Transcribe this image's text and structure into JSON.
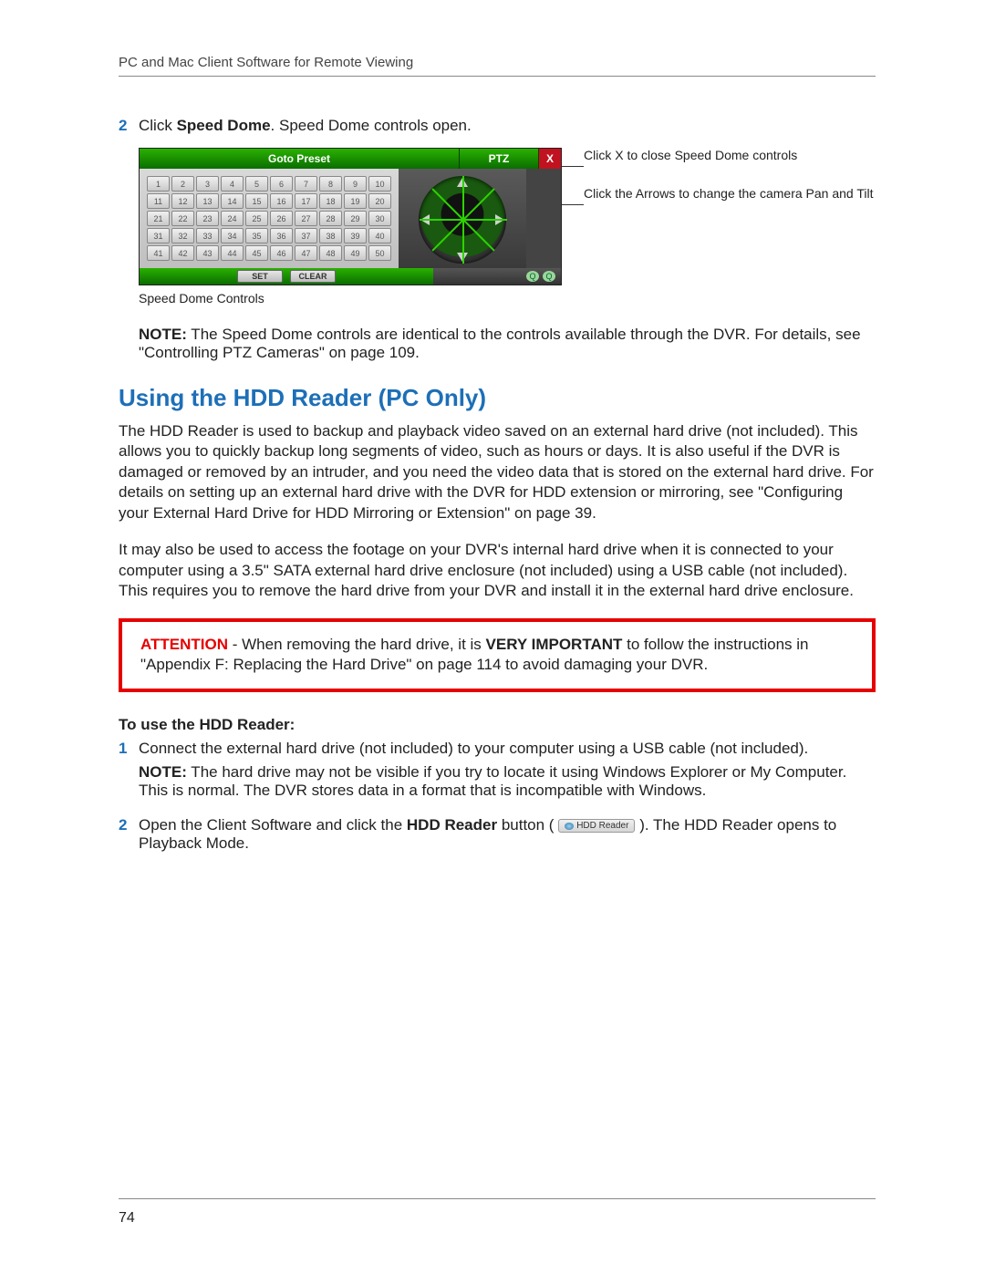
{
  "header": "PC and Mac Client Software for Remote Viewing",
  "page_number": "74",
  "step2": {
    "num": "2",
    "text_a": "Click ",
    "bold": "Speed Dome",
    "text_b": ". Speed Dome controls open."
  },
  "panel": {
    "goto": "Goto Preset",
    "ptz": "PTZ",
    "close": "X",
    "set": "SET",
    "clear": "CLEAR",
    "zoom_out": "Q",
    "zoom_in": "Q"
  },
  "annot": {
    "close": "Click X to close Speed Dome controls",
    "arrows": "Click the Arrows to change the camera Pan and Tilt"
  },
  "caption": "Speed Dome Controls",
  "note1_label": "NOTE:",
  "note1_body": " The Speed Dome controls are identical to the controls available through the DVR. For details, see \"Controlling PTZ Cameras\" on page 109.",
  "section_heading": "Using the HDD Reader (PC Only)",
  "para1": "The HDD Reader is used to backup and playback video saved on an external hard drive (not included). This allows you to quickly backup long segments of video, such as hours or days. It is also useful if the DVR is damaged or removed by an intruder, and you need the video data that is stored on the external hard drive. For details on setting up an external hard drive with the DVR for HDD extension or mirroring, see \"Configuring your External Hard Drive for HDD Mirroring or Extension\" on page 39.",
  "para2": "It may also be used to access the footage on your DVR's internal hard drive when it is connected to your computer using a 3.5\" SATA external hard drive enclosure (not included) using a USB cable (not included). This requires you to remove the hard drive from your DVR and install it in the external hard drive enclosure.",
  "attn": {
    "label": "ATTENTION",
    "a": " - When removing the hard drive, it is ",
    "b": "VERY IMPORTANT",
    "c": " to follow the instructions in \"Appendix F: Replacing the Hard Drive\" on page 114 to avoid damaging your DVR."
  },
  "sub_heading": "To use the HDD Reader:",
  "step_hdd1": {
    "num": "1",
    "body": "Connect the external hard drive (not included) to your computer using a USB cable (not included).",
    "note_label": "NOTE:",
    "note_body": " The hard drive may not be visible if you try to locate it using Windows Explorer or My Computer. This is normal. The DVR stores data in a format that is incompatible with Windows."
  },
  "step_hdd2": {
    "num": "2",
    "a": "Open the Client Software and click the ",
    "b": "HDD Reader",
    "c": " button (",
    "btn": "HDD Reader",
    "d": "). The HDD Reader opens to Playback Mode."
  }
}
